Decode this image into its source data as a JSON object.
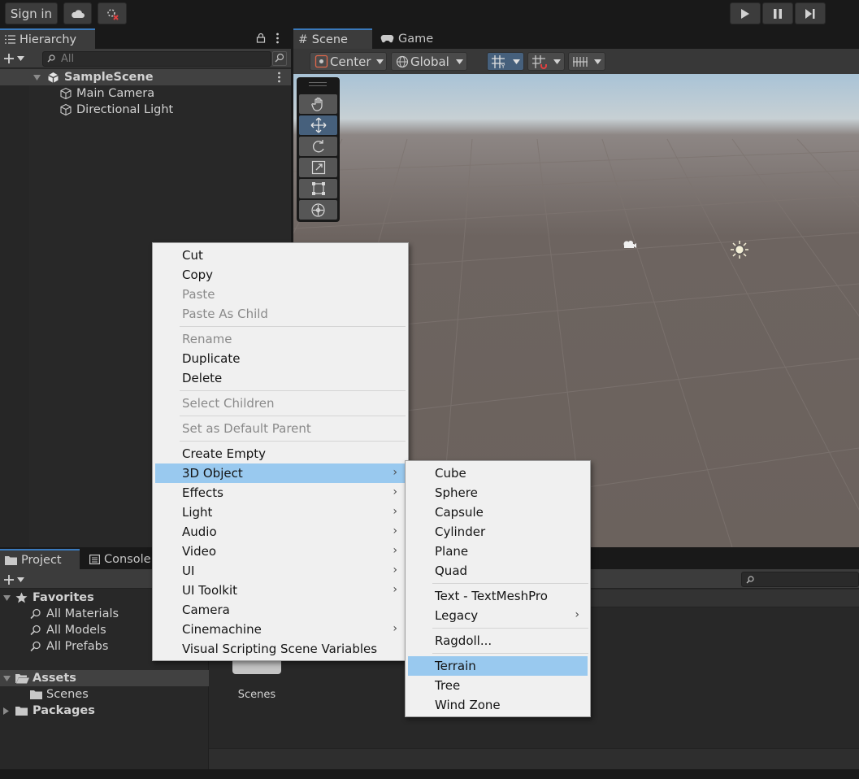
{
  "toolbar": {
    "sign_in": "Sign in",
    "cloud_icon": "cloud-icon",
    "collab_icon": "collab-disconnected-icon",
    "play_icon": "play-icon",
    "pause_icon": "pause-icon",
    "step_icon": "step-icon"
  },
  "hierarchy": {
    "tab": "Hierarchy",
    "search_placeholder": "All",
    "scene": "SampleScene",
    "items": [
      "Main Camera",
      "Directional Light"
    ]
  },
  "scene_view": {
    "tabs": [
      "Scene",
      "Game"
    ],
    "pivot": "Center",
    "space": "Global"
  },
  "project": {
    "tabs": [
      "Project",
      "Console"
    ],
    "favorites_label": "Favorites",
    "favorites": [
      "All Materials",
      "All Models",
      "All Prefabs"
    ],
    "assets_label": "Assets",
    "scenes_label": "Scenes",
    "packages_label": "Packages",
    "grid_item": "Scenes"
  },
  "context_menu": {
    "items": [
      {
        "label": "Cut",
        "state": "enabled"
      },
      {
        "label": "Copy",
        "state": "enabled"
      },
      {
        "label": "Paste",
        "state": "disabled"
      },
      {
        "label": "Paste As Child",
        "state": "disabled"
      },
      {
        "label": "Rename",
        "state": "disabled"
      },
      {
        "label": "Duplicate",
        "state": "enabled"
      },
      {
        "label": "Delete",
        "state": "enabled"
      },
      {
        "label": "Select Children",
        "state": "disabled"
      },
      {
        "label": "Set as Default Parent",
        "state": "disabled"
      },
      {
        "label": "Create Empty",
        "state": "enabled"
      },
      {
        "label": "3D Object",
        "state": "highlighted",
        "submenu": true
      },
      {
        "label": "Effects",
        "submenu": true
      },
      {
        "label": "Light",
        "submenu": true
      },
      {
        "label": "Audio",
        "submenu": true
      },
      {
        "label": "Video",
        "submenu": true
      },
      {
        "label": "UI",
        "submenu": true
      },
      {
        "label": "UI Toolkit",
        "submenu": true
      },
      {
        "label": "Camera"
      },
      {
        "label": "Cinemachine",
        "submenu": true
      },
      {
        "label": "Visual Scripting Scene Variables"
      }
    ]
  },
  "submenu_3d": {
    "items": [
      {
        "label": "Cube"
      },
      {
        "label": "Sphere"
      },
      {
        "label": "Capsule"
      },
      {
        "label": "Cylinder"
      },
      {
        "label": "Plane"
      },
      {
        "label": "Quad"
      },
      {
        "label": "Text - TextMeshPro"
      },
      {
        "label": "Legacy",
        "submenu": true
      },
      {
        "label": "Ragdoll..."
      },
      {
        "label": "Terrain",
        "state": "highlighted"
      },
      {
        "label": "Tree"
      },
      {
        "label": "Wind Zone"
      }
    ]
  },
  "colors": {
    "menu_bg": "#f0f0f0",
    "highlight": "#99c9ef",
    "accent": "#3a79bb"
  }
}
